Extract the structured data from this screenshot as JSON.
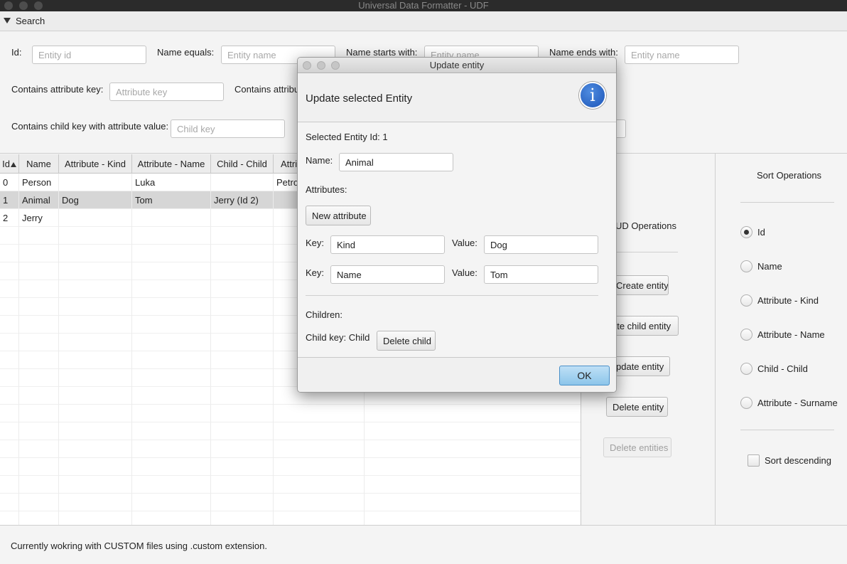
{
  "window": {
    "title": "Universal Data Formatter - UDF"
  },
  "search": {
    "header": "Search",
    "id_label": "Id:",
    "id_placeholder": "Entity id",
    "name_equals_label": "Name equals:",
    "name_equals_placeholder": "Entity name",
    "name_starts_label": "Name starts with:",
    "name_starts_placeholder": "Entity name",
    "name_ends_label": "Name ends with:",
    "name_ends_placeholder": "Entity name",
    "attr_key_label": "Contains attribute key:",
    "attr_key_placeholder": "Attribute key",
    "attr_value_label_partial": "Contains attribu",
    "child_key_label": "Contains child key with attribute value:",
    "child_key_placeholder": "Child key"
  },
  "table": {
    "columns": [
      "Id",
      "Name",
      "Attribute - Kind",
      "Attribute - Name",
      "Child - Child",
      "Attri"
    ],
    "rows": [
      [
        "0",
        "Person",
        "",
        "Luka",
        "",
        "Petro"
      ],
      [
        "1",
        "Animal",
        "Dog",
        "Tom",
        "Jerry (Id 2)",
        ""
      ],
      [
        "2",
        "Jerry",
        "",
        "",
        "",
        ""
      ]
    ]
  },
  "crud": {
    "title": "UD Operations",
    "create": "Create entity",
    "create_child": "ate child entity",
    "update": "pdate entity",
    "delete": "Delete entity",
    "delete_many": "Delete entities"
  },
  "sort": {
    "title": "Sort Operations",
    "options": [
      "Id",
      "Name",
      "Attribute - Kind",
      "Attribute - Name",
      "Child - Child",
      "Attribute - Surname"
    ],
    "selected": "Id",
    "descending_label": "Sort descending"
  },
  "status": {
    "text": "Currently wokring with CUSTOM files using .custom extension."
  },
  "dialog": {
    "title": "Update entity",
    "header": "Update selected Entity",
    "info_glyph": "i",
    "selected_id": "Selected Entity Id: 1",
    "name_label": "Name:",
    "name_value": "Animal",
    "attributes_label": "Attributes:",
    "new_attribute": "New attribute",
    "attributes": [
      {
        "key_label": "Key:",
        "key": "Kind",
        "value_label": "Value:",
        "value": "Dog"
      },
      {
        "key_label": "Key:",
        "key": "Name",
        "value_label": "Value:",
        "value": "Tom"
      }
    ],
    "children_label": "Children:",
    "child_key": "Child key: Child",
    "delete_child": "Delete child",
    "ok": "OK"
  }
}
